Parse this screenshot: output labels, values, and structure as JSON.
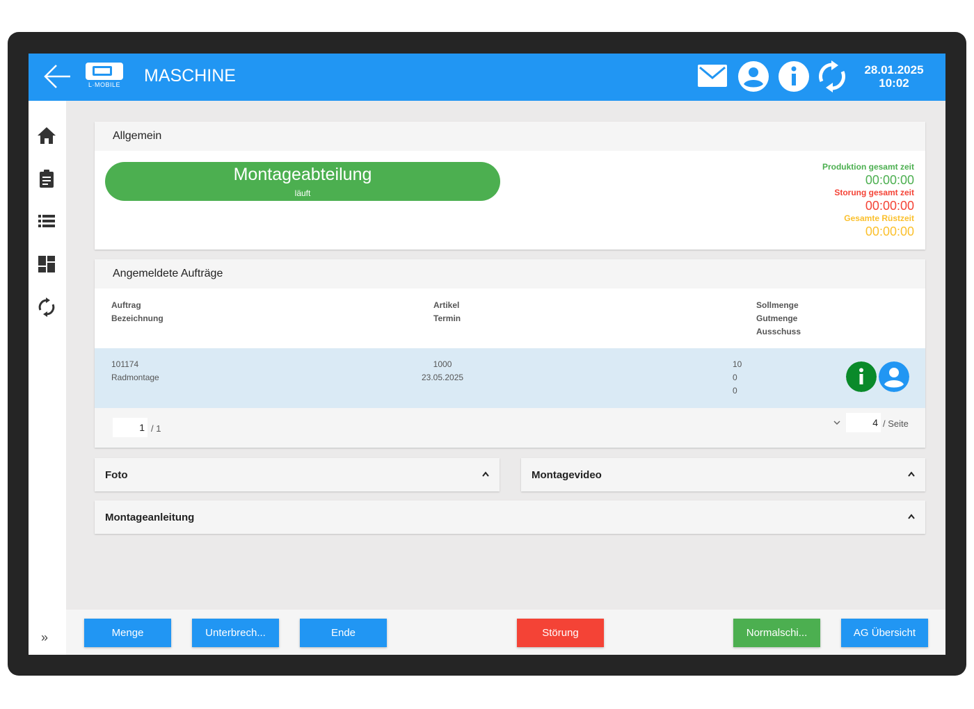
{
  "header": {
    "logo_text": "L·MOBILE",
    "title": "MASCHINE",
    "icons": [
      "mail-icon",
      "account-icon",
      "info-icon",
      "refresh-icon"
    ],
    "date": "28.01.2025",
    "time": "10:02"
  },
  "sidebar": {
    "items": [
      "home-icon",
      "clipboard-icon",
      "list-icon",
      "dashboard-icon",
      "sync-icon"
    ],
    "expand_label": "»"
  },
  "general": {
    "title": "Allgemein",
    "department": "Montageabteilung",
    "status": "läuft",
    "timers": [
      {
        "label": "Produktion gesamt zeit",
        "value": "00:00:00",
        "color": "#4caf50"
      },
      {
        "label": "Storung gesamt zeit",
        "value": "00:00:00",
        "color": "#f44336"
      },
      {
        "label": "Gesamte Rüstzeit",
        "value": "00:00:00",
        "color": "#fbc02d"
      }
    ]
  },
  "orders": {
    "title": "Angemeldete Aufträge",
    "columns": {
      "col1": [
        "Auftrag",
        "Bezeichnung"
      ],
      "col2": [
        "Artikel",
        "Termin"
      ],
      "col3": [
        "Sollmenge",
        "Gutmenge",
        "Ausschuss"
      ]
    },
    "rows": [
      {
        "auftrag": "101174",
        "bezeichnung": "Radmontage",
        "artikel": "1000",
        "termin": "23.05.2025",
        "sollmenge": "10",
        "gutmenge": "0",
        "ausschuss": "0"
      }
    ],
    "pager": {
      "page": "1",
      "of": "/ 1",
      "per_page": "4",
      "per_page_label": "/ Seite"
    }
  },
  "panels": {
    "foto": "Foto",
    "montagevideo": "Montagevideo",
    "montageanleitung": "Montageanleitung"
  },
  "actions": {
    "menge": "Menge",
    "unterbrechung": "Unterbrech...",
    "ende": "Ende",
    "stoerung": "Störung",
    "normalschicht": "Normalschi...",
    "ag_uebersicht": "AG Übersicht"
  },
  "colors": {
    "primary": "#2196f3",
    "success": "#4caf50",
    "danger": "#f44336",
    "info_green": "#0a8a2a",
    "row_selected": "#daeaf5"
  }
}
